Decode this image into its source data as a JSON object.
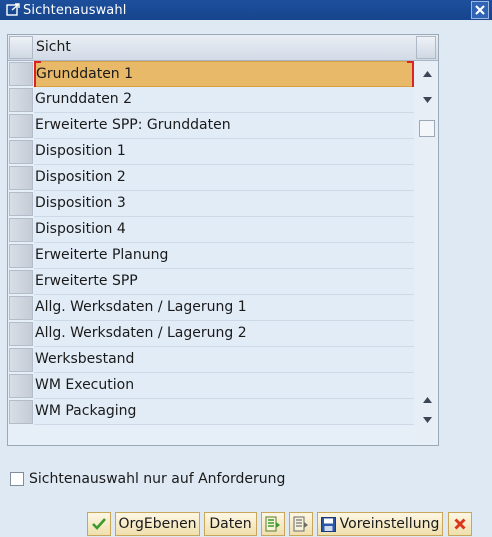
{
  "window": {
    "title": "Sichtenauswahl",
    "close_icon": "close-icon"
  },
  "table": {
    "column_header": "Sicht",
    "rows": [
      "Grunddaten 1",
      "Grunddaten 2",
      "Erweiterte SPP: Grunddaten",
      "Disposition 1",
      "Disposition 2",
      "Disposition 3",
      "Disposition 4",
      "Erweiterte Planung",
      "Erweiterte SPP",
      "Allg. Werksdaten / Lagerung 1",
      "Allg. Werksdaten / Lagerung 2",
      "Werksbestand",
      "WM Execution",
      "WM Packaging"
    ],
    "selected_row": "Grunddaten 1"
  },
  "checkbox": {
    "label": "Sichtenauswahl nur auf Anforderung",
    "checked": false
  },
  "footer": {
    "confirm_icon": "check-icon",
    "orgebenen_label": "OrgEbenen",
    "daten_label": "Daten",
    "select_all_icon": "select-all-icon",
    "deselect_all_icon": "deselect-all-icon",
    "voreinstellung_label": "Voreinstellung",
    "save_icon": "save-icon",
    "cancel_icon": "cancel-icon"
  },
  "colors": {
    "titlebar": "#1d4f9c",
    "selection": "#e8b968",
    "background": "#dfe9f4",
    "cancel": "#d9381e",
    "confirm": "#3c9a2a"
  }
}
